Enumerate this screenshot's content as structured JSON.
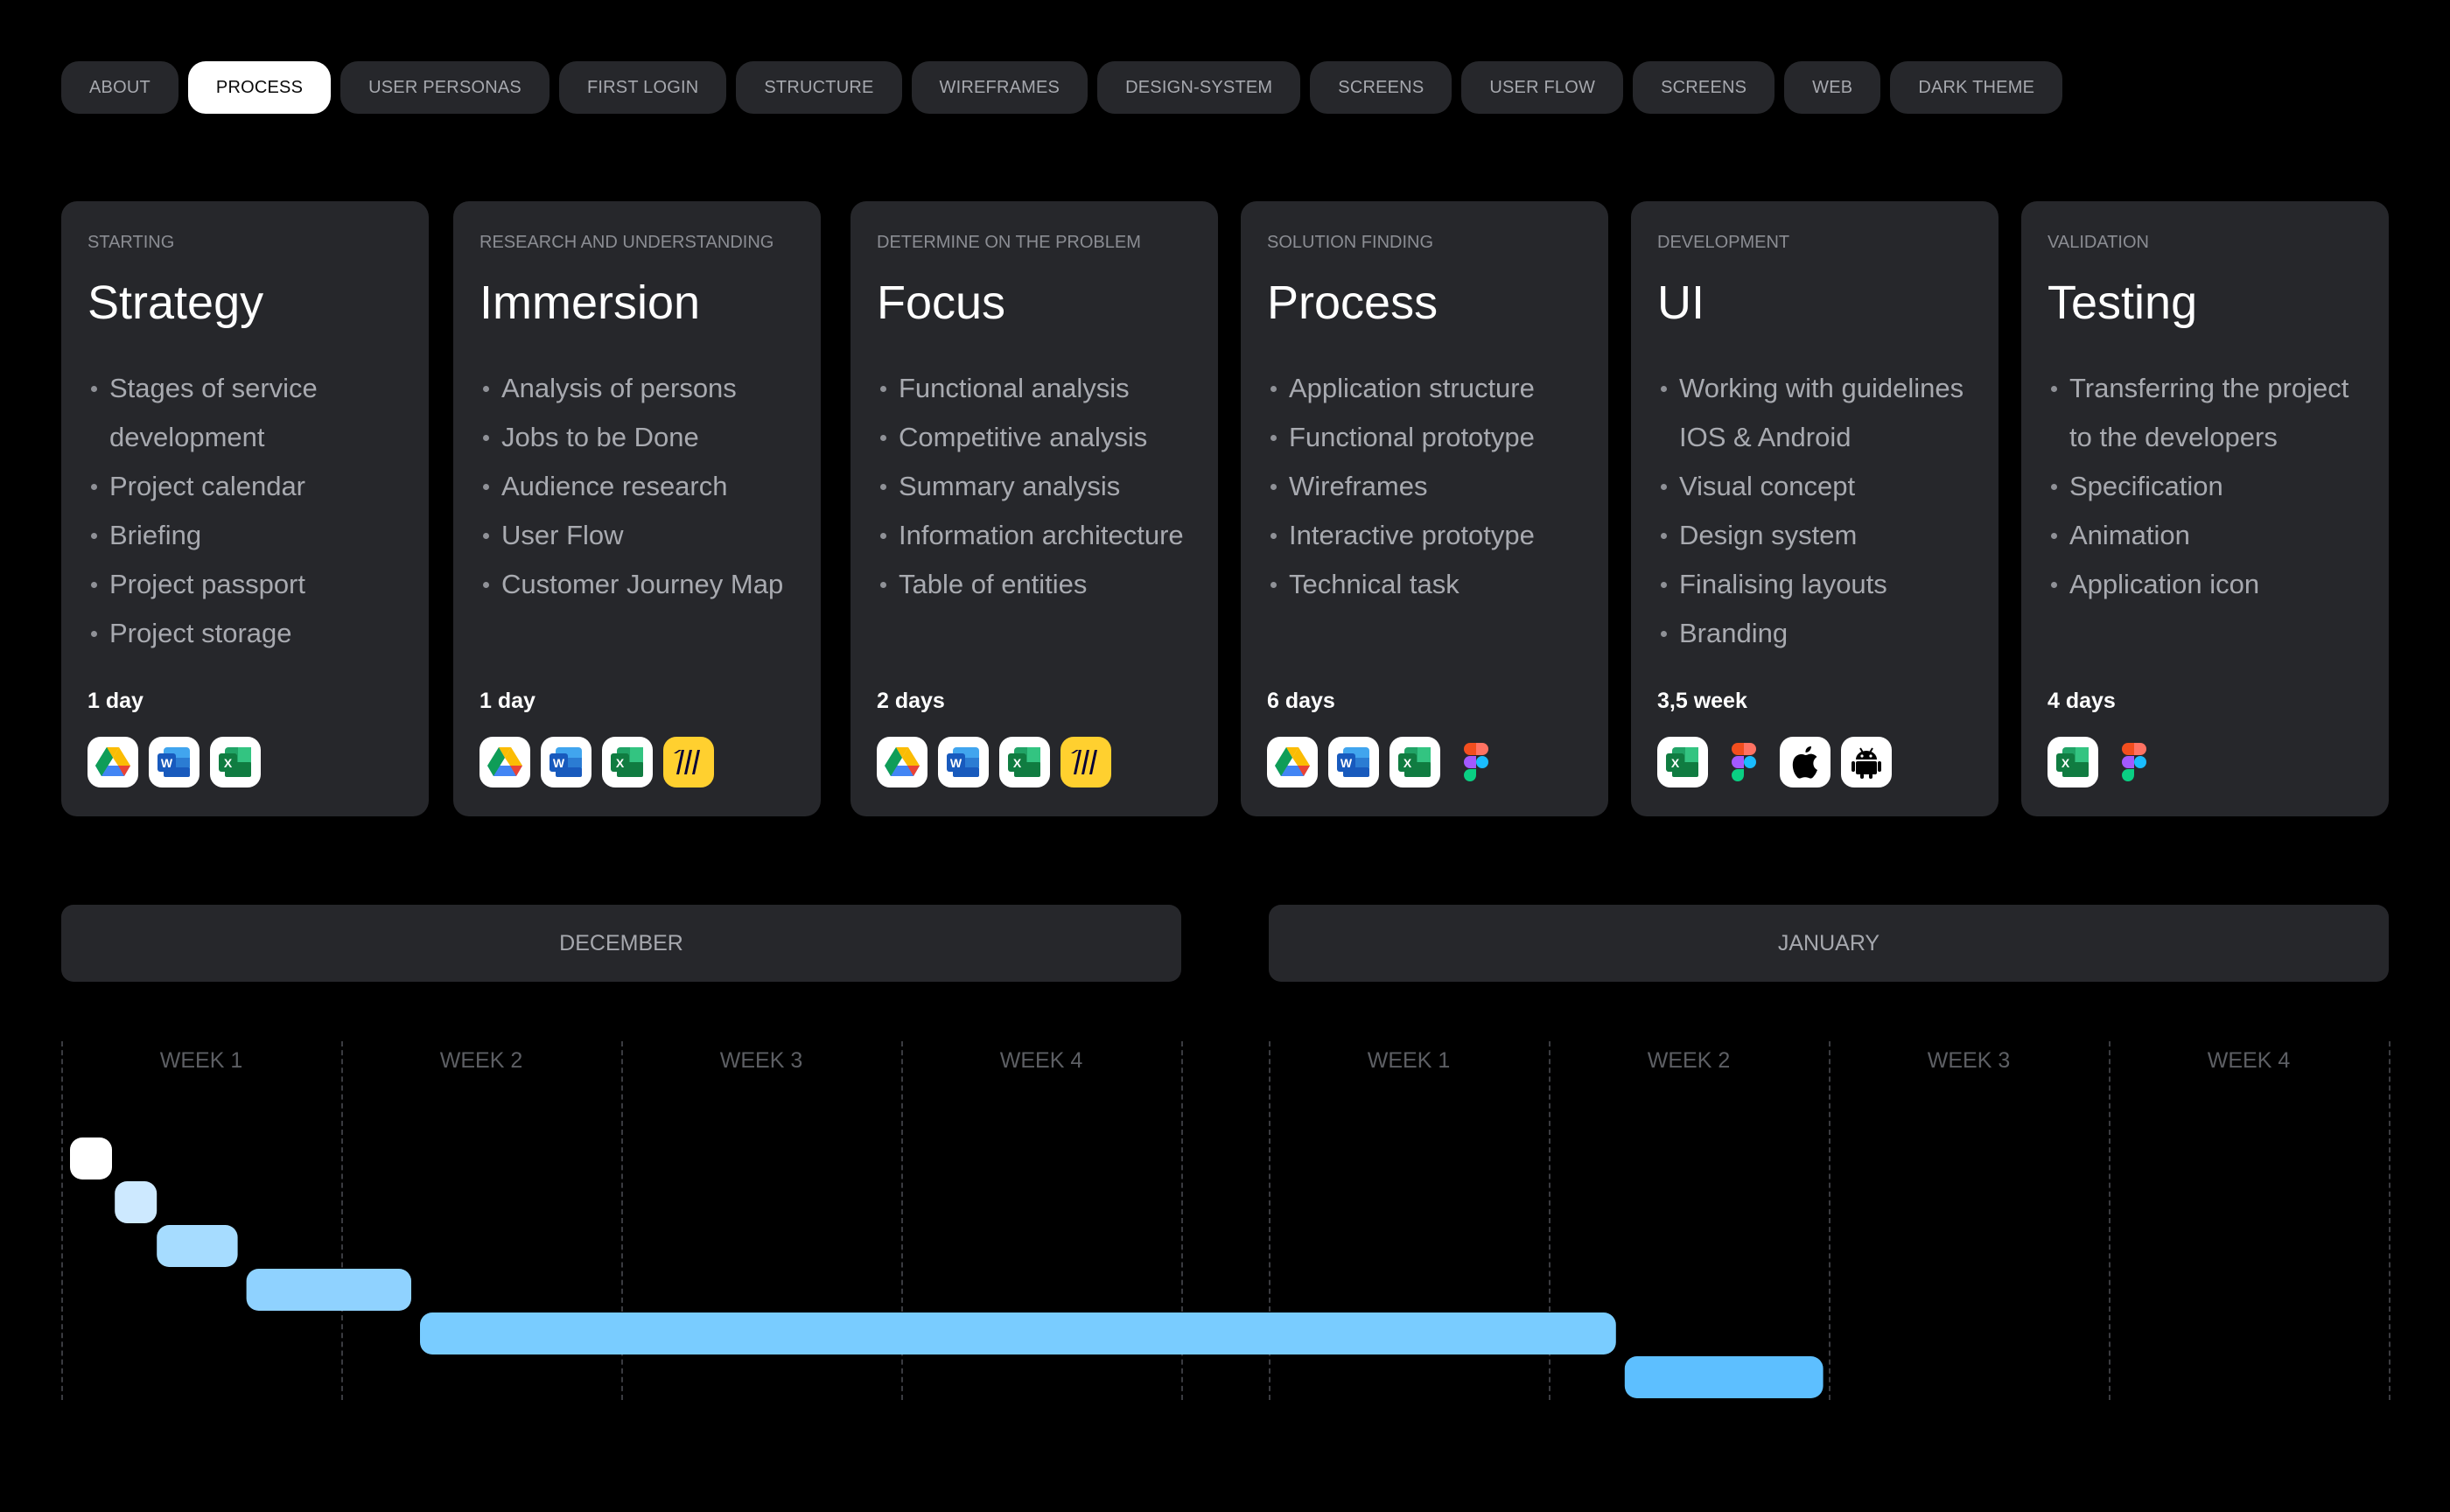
{
  "tabs": [
    {
      "label": "About",
      "active": false
    },
    {
      "label": "Process",
      "active": true
    },
    {
      "label": "User personas",
      "active": false
    },
    {
      "label": "First login",
      "active": false
    },
    {
      "label": "Structure",
      "active": false
    },
    {
      "label": "Wireframes",
      "active": false
    },
    {
      "label": "Design-system",
      "active": false
    },
    {
      "label": "Screens",
      "active": false
    },
    {
      "label": "User flow",
      "active": false
    },
    {
      "label": "Screens",
      "active": false
    },
    {
      "label": "Web",
      "active": false
    },
    {
      "label": "Dark theme",
      "active": false
    }
  ],
  "stages": [
    {
      "kicker": "Starting",
      "title": "Strategy",
      "items": [
        "Stages of service development",
        "Project calendar",
        "Briefing",
        "Project passport",
        "Project storage"
      ],
      "duration": "1 day",
      "tools": [
        "google-drive",
        "word",
        "excel"
      ]
    },
    {
      "kicker": "Research and understanding",
      "title": "Immersion",
      "items": [
        "Analysis of persons",
        "Jobs to be Done",
        "Audience research",
        "User Flow",
        "Customer Journey Map"
      ],
      "duration": "1 day",
      "tools": [
        "google-drive",
        "word",
        "excel",
        "miro"
      ]
    },
    {
      "kicker": "Determine on the problem",
      "title": "Focus",
      "items": [
        "Functional analysis",
        "Competitive analysis",
        "Summary analysis",
        "Information architecture",
        "Table of entities"
      ],
      "duration": "2 days",
      "tools": [
        "google-drive",
        "word",
        "excel",
        "miro"
      ]
    },
    {
      "kicker": "Solution finding",
      "title": "Process",
      "items": [
        "Application structure",
        "Functional prototype",
        "Wireframes",
        "Interactive prototype",
        "Technical task"
      ],
      "duration": "6 days",
      "tools": [
        "google-drive",
        "word",
        "excel",
        "figma"
      ]
    },
    {
      "kicker": "Development",
      "title": "UI",
      "items": [
        "Working with guidelines IOS & Android",
        "Visual concept",
        "Design system",
        "Finalising layouts",
        "Branding"
      ],
      "duration": "3,5 week",
      "tools": [
        "excel",
        "figma",
        "apple",
        "android"
      ]
    },
    {
      "kicker": "Validation",
      "title": "Testing",
      "items": [
        "Transferring the project to the developers",
        "Specification",
        "Animation",
        "Application icon"
      ],
      "duration": "4 days",
      "tools": [
        "excel",
        "figma"
      ]
    }
  ],
  "timeline": {
    "months": [
      {
        "label": "December",
        "weeks": [
          "Week 1",
          "Week 2",
          "Week 3",
          "Week 4"
        ]
      },
      {
        "label": "January",
        "weeks": [
          "Week 1",
          "Week 2",
          "Week 3",
          "Week 4"
        ]
      }
    ],
    "tasks": [
      {
        "stage": "Strategy",
        "start_week": 0.0,
        "end_week": 0.16,
        "color": "#ffffff"
      },
      {
        "stage": "Immersion",
        "start_week": 0.16,
        "end_week": 0.31,
        "color": "#cde9ff"
      },
      {
        "stage": "Focus",
        "start_week": 0.31,
        "end_week": 0.63,
        "color": "#a6dcff"
      },
      {
        "stage": "Process",
        "start_week": 0.63,
        "end_week": 1.25,
        "color": "#8fd2ff"
      },
      {
        "stage": "UI",
        "start_week": 1.25,
        "end_week": 5.24,
        "color": "#79ccff"
      },
      {
        "stage": "Testing",
        "start_week": 5.24,
        "end_week": 5.98,
        "color": "#5dbfff"
      }
    ]
  },
  "colors": {
    "background": "#000000",
    "card": "#26272b",
    "active_tab": "#ffffff"
  }
}
